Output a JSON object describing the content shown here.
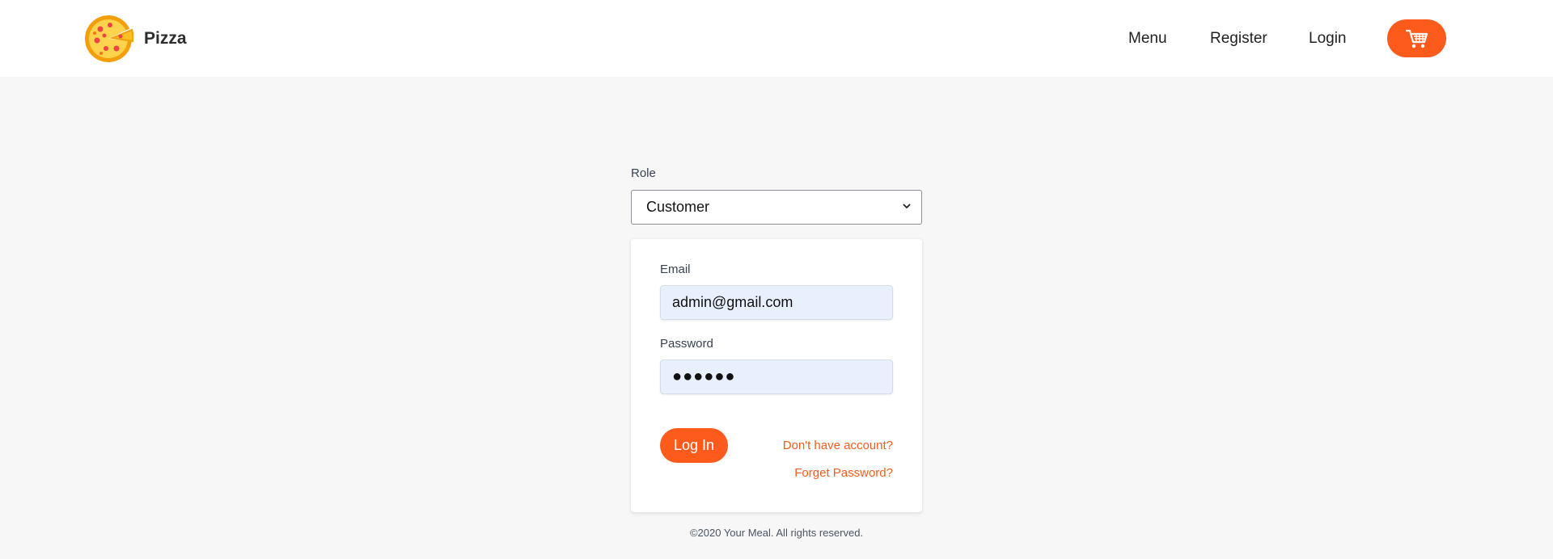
{
  "brand": {
    "name": "Pizza",
    "logo_icon": "pizza-icon"
  },
  "nav": {
    "items": [
      {
        "label": "Menu"
      },
      {
        "label": "Register"
      },
      {
        "label": "Login"
      }
    ],
    "cart_icon": "shopping-cart-icon"
  },
  "login": {
    "role_label": "Role",
    "role_value": "Customer",
    "email_label": "Email",
    "email_value": "admin@gmail.com",
    "password_label": "Password",
    "password_value": "●●●●●●",
    "login_button": "Log In",
    "no_account_link": "Don't have account?",
    "forgot_link": "Forget Password?"
  },
  "footer": {
    "text": "©2020 Your Meal. All rights reserved."
  },
  "colors": {
    "accent": "#fd5b1c",
    "background": "#f7f7f7",
    "input_fill": "#e8f0fd"
  }
}
